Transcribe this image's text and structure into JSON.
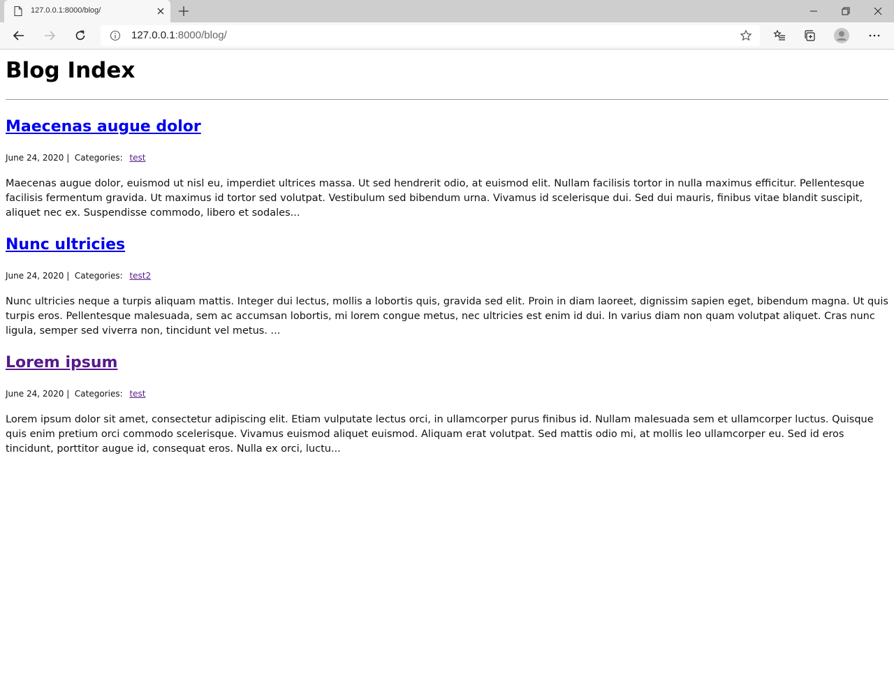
{
  "browser": {
    "tab_title": "127.0.0.1:8000/blog/",
    "url_host": "127.0.0.1",
    "url_rest": ":8000/blog/"
  },
  "page": {
    "title": "Blog Index",
    "posts": [
      {
        "title": "Maecenas augue dolor",
        "date": "June 24, 2020 |",
        "categories_label": "Categories:",
        "category": "test",
        "excerpt": "Maecenas augue dolor, euismod ut nisl eu, imperdiet ultrices massa. Ut sed hendrerit odio, at euismod elit. Nullam facilisis tortor in nulla maximus efficitur. Pellentesque facilisis fermentum gravida. Ut maximus id tortor sed volutpat. Vestibulum sed bibendum urna. Vivamus id scelerisque dui. Sed dui mauris, finibus vitae blandit suscipit, aliquet nec ex. Suspendisse commodo, libero et sodales..."
      },
      {
        "title": "Nunc ultricies",
        "date": "June 24, 2020 |",
        "categories_label": "Categories:",
        "category": "test2",
        "excerpt": "Nunc ultricies neque a turpis aliquam mattis. Integer dui lectus, mollis a lobortis quis, gravida sed elit. Proin in diam laoreet, dignissim sapien eget, bibendum magna. Ut quis turpis eros. Pellentesque malesuada, sem ac accumsan lobortis, mi lorem congue metus, nec ultricies est enim id dui. In varius diam non quam volutpat aliquet. Cras nunc ligula, semper sed viverra non, tincidunt vel metus. ..."
      },
      {
        "title": "Lorem ipsum",
        "date": "June 24, 2020 |",
        "categories_label": "Categories:",
        "category": "test",
        "excerpt": "Lorem ipsum dolor sit amet, consectetur adipiscing elit. Etiam vulputate lectus orci, in ullamcorper purus finibus id. Nullam malesuada sem et ullamcorper luctus. Quisque quis enim pretium orci commodo scelerisque. Vivamus euismod aliquet euismod. Aliquam erat volutpat. Sed mattis odio mi, at mollis leo ullamcorper eu. Sed id eros tincidunt, porttitor augue id, consequat eros. Nulla ex orci, luctu..."
      }
    ]
  },
  "colors": {
    "link": "#0000ee",
    "visited_link": "#551a8b"
  }
}
